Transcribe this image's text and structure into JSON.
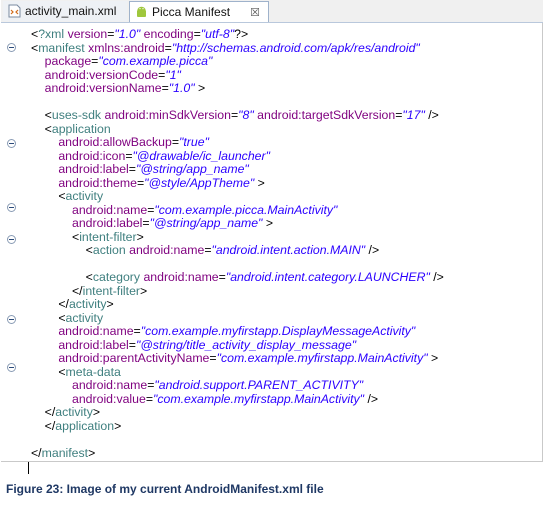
{
  "tabs": [
    {
      "label": "activity_main.xml",
      "active": false,
      "icon": "xml-file-icon"
    },
    {
      "label": "Picca Manifest",
      "active": true,
      "icon": "android-manifest-icon",
      "close": "☒"
    }
  ],
  "code_lines": [
    [
      [
        "p",
        "<"
      ],
      [
        "t",
        "?xml"
      ],
      [
        "a",
        " version"
      ],
      [
        "p",
        "="
      ],
      [
        "v",
        "\"1.0\""
      ],
      [
        "a",
        " encoding"
      ],
      [
        "p",
        "="
      ],
      [
        "v",
        "\"utf-8\""
      ],
      [
        "p",
        "?>"
      ]
    ],
    [
      [
        "p",
        "<"
      ],
      [
        "t",
        "manifest"
      ],
      [
        "a",
        " xmlns:android"
      ],
      [
        "p",
        "="
      ],
      [
        "v",
        "\"http://schemas.android.com/apk/res/android\""
      ]
    ],
    [
      [
        "p",
        "    "
      ],
      [
        "a",
        "package"
      ],
      [
        "p",
        "="
      ],
      [
        "v",
        "\"com.example.picca\""
      ]
    ],
    [
      [
        "p",
        "    "
      ],
      [
        "a",
        "android:versionCode"
      ],
      [
        "p",
        "="
      ],
      [
        "v",
        "\"1\""
      ]
    ],
    [
      [
        "p",
        "    "
      ],
      [
        "a",
        "android:versionName"
      ],
      [
        "p",
        "="
      ],
      [
        "v",
        "\"1.0\""
      ],
      [
        "p",
        " >"
      ]
    ],
    [
      [
        "p",
        ""
      ]
    ],
    [
      [
        "p",
        "    <"
      ],
      [
        "t",
        "uses-sdk"
      ],
      [
        "a",
        " android:minSdkVersion"
      ],
      [
        "p",
        "="
      ],
      [
        "v",
        "\"8\""
      ],
      [
        "a",
        " android:targetSdkVersion"
      ],
      [
        "p",
        "="
      ],
      [
        "v",
        "\"17\""
      ],
      [
        "p",
        " />"
      ]
    ],
    [
      [
        "p",
        "    <"
      ],
      [
        "t",
        "application"
      ]
    ],
    [
      [
        "p",
        "        "
      ],
      [
        "a",
        "android:allowBackup"
      ],
      [
        "p",
        "="
      ],
      [
        "v",
        "\"true\""
      ]
    ],
    [
      [
        "p",
        "        "
      ],
      [
        "a",
        "android:icon"
      ],
      [
        "p",
        "="
      ],
      [
        "v",
        "\"@drawable/ic_launcher\""
      ]
    ],
    [
      [
        "p",
        "        "
      ],
      [
        "a",
        "android:label"
      ],
      [
        "p",
        "="
      ],
      [
        "v",
        "\"@string/app_name\""
      ]
    ],
    [
      [
        "p",
        "        "
      ],
      [
        "a",
        "android:theme"
      ],
      [
        "p",
        "="
      ],
      [
        "v",
        "\"@style/AppTheme\""
      ],
      [
        "p",
        " >"
      ]
    ],
    [
      [
        "p",
        "        <"
      ],
      [
        "t",
        "activity"
      ]
    ],
    [
      [
        "p",
        "            "
      ],
      [
        "a",
        "android:name"
      ],
      [
        "p",
        "="
      ],
      [
        "v",
        "\"com.example.picca.MainActivity\""
      ]
    ],
    [
      [
        "p",
        "            "
      ],
      [
        "a",
        "android:label"
      ],
      [
        "p",
        "="
      ],
      [
        "v",
        "\"@string/app_name\""
      ],
      [
        "p",
        " >"
      ]
    ],
    [
      [
        "p",
        "            <"
      ],
      [
        "t",
        "intent-filter"
      ],
      [
        "p",
        ">"
      ]
    ],
    [
      [
        "p",
        "                <"
      ],
      [
        "t",
        "action"
      ],
      [
        "a",
        " android:name"
      ],
      [
        "p",
        "="
      ],
      [
        "v",
        "\"android.intent.action.MAIN\""
      ],
      [
        "p",
        " />"
      ]
    ],
    [
      [
        "p",
        ""
      ]
    ],
    [
      [
        "p",
        "                <"
      ],
      [
        "t",
        "category"
      ],
      [
        "a",
        " android:name"
      ],
      [
        "p",
        "="
      ],
      [
        "v",
        "\"android.intent.category.LAUNCHER\""
      ],
      [
        "p",
        " />"
      ]
    ],
    [
      [
        "p",
        "            </"
      ],
      [
        "t",
        "intent-filter"
      ],
      [
        "p",
        ">"
      ]
    ],
    [
      [
        "p",
        "        </"
      ],
      [
        "t",
        "activity"
      ],
      [
        "p",
        ">"
      ]
    ],
    [
      [
        "p",
        "        <"
      ],
      [
        "t",
        "activity"
      ]
    ],
    [
      [
        "p",
        "        "
      ],
      [
        "a",
        "android:name"
      ],
      [
        "p",
        "="
      ],
      [
        "v",
        "\"com.example.myfirstapp.DisplayMessageActivity\""
      ]
    ],
    [
      [
        "p",
        "        "
      ],
      [
        "a",
        "android:label"
      ],
      [
        "p",
        "="
      ],
      [
        "v",
        "\"@string/title_activity_display_message\""
      ]
    ],
    [
      [
        "p",
        "        "
      ],
      [
        "a",
        "android:parentActivityName"
      ],
      [
        "p",
        "="
      ],
      [
        "v",
        "\"com.example.myfirstapp.MainActivity\""
      ],
      [
        "p",
        " >"
      ]
    ],
    [
      [
        "p",
        "        <"
      ],
      [
        "t",
        "meta-data"
      ]
    ],
    [
      [
        "p",
        "            "
      ],
      [
        "a",
        "android:name"
      ],
      [
        "p",
        "="
      ],
      [
        "v",
        "\"android.support.PARENT_ACTIVITY\""
      ]
    ],
    [
      [
        "p",
        "            "
      ],
      [
        "a",
        "android:value"
      ],
      [
        "p",
        "="
      ],
      [
        "v",
        "\"com.example.myfirstapp.MainActivity\""
      ],
      [
        "p",
        " />"
      ]
    ],
    [
      [
        "p",
        "    </"
      ],
      [
        "t",
        "activity"
      ],
      [
        "p",
        ">"
      ]
    ],
    [
      [
        "p",
        "    </"
      ],
      [
        "t",
        "application"
      ],
      [
        "p",
        ">"
      ]
    ],
    [
      [
        "p",
        ""
      ]
    ],
    [
      [
        "p",
        "</"
      ],
      [
        "t",
        "manifest"
      ],
      [
        "p",
        ">"
      ]
    ]
  ],
  "caption": "Figure 23: Image of my current AndroidManifest.xml file"
}
